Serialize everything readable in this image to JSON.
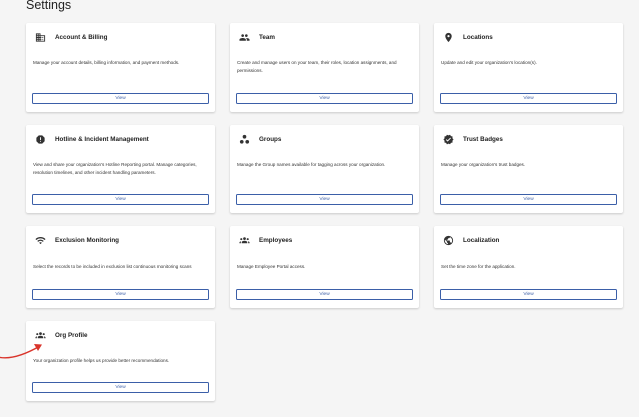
{
  "page": {
    "title": "Settings"
  },
  "cards": [
    {
      "title": "Account & Billing",
      "description": "Manage your account details, billing information, and payment methods.",
      "button": "View",
      "icon": "building-icon"
    },
    {
      "title": "Team",
      "description": "Create and manage users on your team, their roles, location assignments, and permissions.",
      "button": "View",
      "icon": "people-icon"
    },
    {
      "title": "Locations",
      "description": "Update and edit your organization's location(s).",
      "button": "View",
      "icon": "location-pin-icon"
    },
    {
      "title": "Hotline & Incident Management",
      "description": "View and share your organization's Hotline Reporting portal. Manage categories, resolution timelines, and other incident handling parameters.",
      "button": "View",
      "icon": "alert-icon"
    },
    {
      "title": "Groups",
      "description": "Manage the Group names available for tagging across your organization.",
      "button": "View",
      "icon": "groups-icon"
    },
    {
      "title": "Trust Badges",
      "description": "Manage your organization's trust badges.",
      "button": "View",
      "icon": "verified-badge-icon"
    },
    {
      "title": "Exclusion Monitoring",
      "description": "Select the records to be included in exclusion list continuous monitoring scans",
      "button": "View",
      "icon": "wifi-icon"
    },
    {
      "title": "Employees",
      "description": "Manage Employee Portal access.",
      "button": "View",
      "icon": "employees-icon"
    },
    {
      "title": "Localization",
      "description": "Set the time zone for the application.",
      "button": "View",
      "icon": "globe-icon"
    },
    {
      "title": "Org Profile",
      "description": "Your organization profile helps us provide better recommendations.",
      "button": "View",
      "icon": "org-people-icon"
    }
  ],
  "colors": {
    "accent": "#3b5fa8",
    "annotation_arrow": "#d9342b",
    "background": "#f5f5f5",
    "card": "#ffffff"
  }
}
